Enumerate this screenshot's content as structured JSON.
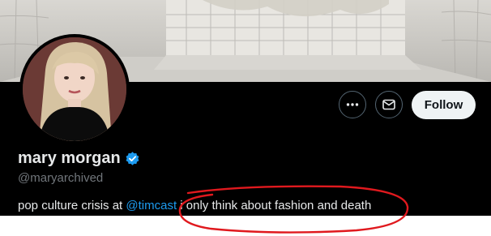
{
  "profile": {
    "display_name": "mary morgan",
    "handle": "@maryarchived",
    "verified": true,
    "bio": {
      "prefix": "pop culture crisis at ",
      "mention": "@timcast",
      "suffix": " i only think about fashion and death"
    }
  },
  "actions": {
    "more_icon": "more-horizontal-icon",
    "message_icon": "envelope-icon",
    "follow_label": "Follow"
  },
  "colors": {
    "background": "#000000",
    "text": "#e7e9ea",
    "muted": "#71767b",
    "accent": "#1d9bf0",
    "follow_bg": "#eff3f4",
    "annotation": "#e0191e"
  }
}
